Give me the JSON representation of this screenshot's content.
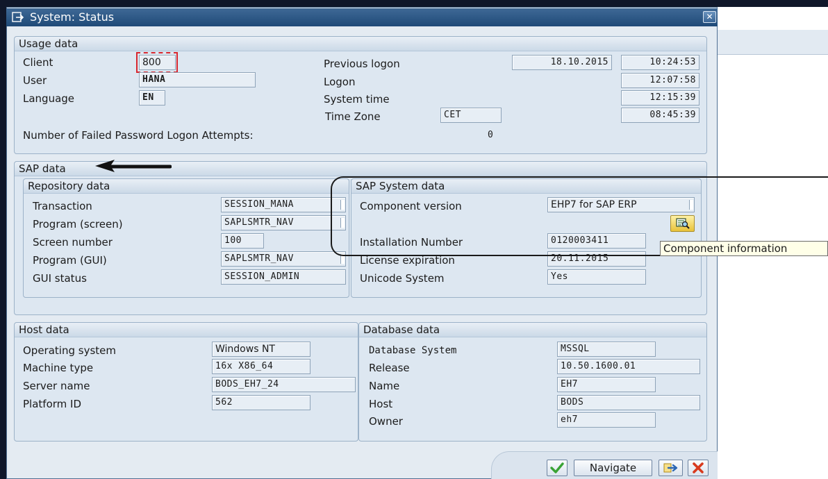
{
  "window": {
    "title": "System: Status",
    "close_symbol": "✕"
  },
  "usage_data": {
    "header": "Usage data",
    "client_label": "Client",
    "client_value": "800",
    "user_label": "User",
    "user_value": "HANA",
    "language_label": "Language",
    "language_value": "EN",
    "previous_logon_label": "Previous logon",
    "previous_logon_date": "18.10.2015",
    "previous_logon_time": "10:24:53",
    "logon_label": "Logon",
    "logon_time": "12:07:58",
    "system_time_label": "System time",
    "system_time_value": "12:15:39",
    "time_zone_label": "Time Zone",
    "time_zone_value": "CET",
    "time_zone_time": "08:45:39",
    "failed_attempts_label": "Number of Failed Password Logon Attempts:",
    "failed_attempts_value": "0"
  },
  "sap_data": {
    "header": "SAP data",
    "repository": {
      "header": "Repository data",
      "rows": [
        {
          "label": "Transaction",
          "value": "SESSION_MANA"
        },
        {
          "label": "Program (screen)",
          "value": "SAPLSMTR_NAV"
        },
        {
          "label": "Screen number",
          "value": "100"
        },
        {
          "label": "Program (GUI)",
          "value": "SAPLSMTR_NAV"
        },
        {
          "label": "GUI status",
          "value": "SESSION_ADMIN"
        }
      ]
    },
    "system": {
      "header": "SAP System data",
      "component_version_label": "Component version",
      "component_version_value": "EHP7 for SAP ERP",
      "installation_number_label": "Installation Number",
      "installation_number_value": "0120003411",
      "license_expiration_label": "License expiration",
      "license_expiration_value": "20.11.2015",
      "unicode_label": "Unicode System",
      "unicode_value": "Yes",
      "tooltip": "Component information"
    }
  },
  "host_data": {
    "header": "Host data",
    "rows": [
      {
        "label": "Operating system",
        "value": "Windows NT"
      },
      {
        "label": "Machine type",
        "value": "16x X86_64"
      },
      {
        "label": "Server name",
        "value": "BODS_EH7_24"
      },
      {
        "label": "Platform ID",
        "value": "562"
      }
    ]
  },
  "database_data": {
    "header": "Database data",
    "rows": [
      {
        "label": "Database System",
        "value": "MSSQL"
      },
      {
        "label": "Release",
        "value": "10.50.1600.01"
      },
      {
        "label": "Name",
        "value": "EH7"
      },
      {
        "label": "Host",
        "value": "BODS"
      },
      {
        "label": "Owner",
        "value": "eh7"
      }
    ]
  },
  "footer": {
    "navigate_label": "Navigate"
  },
  "colors": {
    "accent_title": "#2a5685",
    "annotation_red": "#d8262e",
    "confirm_green": "#3aa335",
    "cancel_red": "#d83a1e"
  }
}
